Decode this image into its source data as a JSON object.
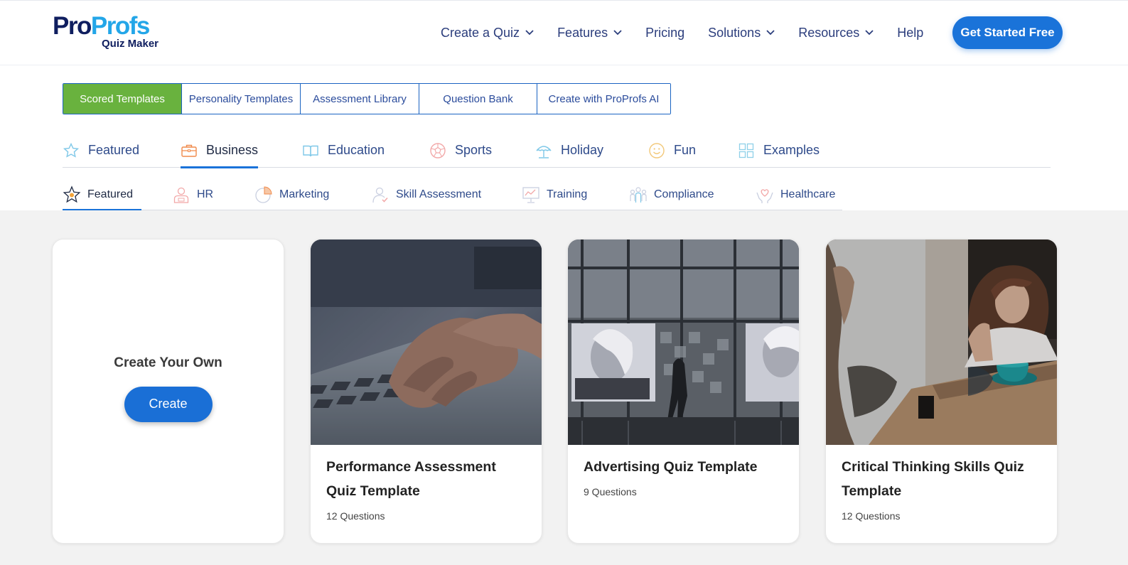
{
  "brand": {
    "name_part1": "Pro",
    "name_part2": "Profs",
    "sub": "Quiz Maker",
    "color_dark": "#0f1e5f",
    "color_light": "#23a6e8"
  },
  "nav": {
    "items": [
      {
        "label": "Create a Quiz",
        "dropdown": true
      },
      {
        "label": "Features",
        "dropdown": true
      },
      {
        "label": "Pricing",
        "dropdown": false
      },
      {
        "label": "Solutions",
        "dropdown": true
      },
      {
        "label": "Resources",
        "dropdown": true
      },
      {
        "label": "Help",
        "dropdown": false
      }
    ],
    "cta_label": "Get Started Free"
  },
  "type_tabs": [
    {
      "label": "Scored Templates",
      "active": true
    },
    {
      "label": "Personality Templates",
      "active": false
    },
    {
      "label": "Assessment Library",
      "active": false
    },
    {
      "label": "Question Bank",
      "active": false
    },
    {
      "label": "Create with ProProfs AI",
      "active": false
    }
  ],
  "category_tabs": [
    {
      "label": "Featured",
      "icon": "star-icon",
      "active": false
    },
    {
      "label": "Business",
      "icon": "briefcase-icon",
      "active": true
    },
    {
      "label": "Education",
      "icon": "book-icon",
      "active": false
    },
    {
      "label": "Sports",
      "icon": "ball-icon",
      "active": false
    },
    {
      "label": "Holiday",
      "icon": "umbrella-icon",
      "active": false
    },
    {
      "label": "Fun",
      "icon": "smiley-icon",
      "active": false
    },
    {
      "label": "Examples",
      "icon": "grid-icon",
      "active": false
    }
  ],
  "sub_tabs": [
    {
      "label": "Featured",
      "icon": "star-badge-icon",
      "active": true
    },
    {
      "label": "HR",
      "icon": "person-icon",
      "active": false
    },
    {
      "label": "Marketing",
      "icon": "pie-chart-icon",
      "active": false
    },
    {
      "label": "Skill Assessment",
      "icon": "person-check-icon",
      "active": false
    },
    {
      "label": "Training",
      "icon": "presentation-icon",
      "active": false
    },
    {
      "label": "Compliance",
      "icon": "group-icon",
      "active": false
    },
    {
      "label": "Healthcare",
      "icon": "heart-hands-icon",
      "active": false
    }
  ],
  "create_card": {
    "title": "Create Your Own",
    "button": "Create"
  },
  "templates": [
    {
      "title": "Performance Assessment Quiz Template",
      "questions": "12 Questions",
      "image": "laptop-typing-photo"
    },
    {
      "title": "Advertising Quiz Template",
      "questions": "9 Questions",
      "image": "building-billboards-photo"
    },
    {
      "title": "Critical Thinking Skills Quiz Template",
      "questions": "12 Questions",
      "image": "cafe-conversation-photo"
    }
  ],
  "colors": {
    "accent_blue": "#1a73d9",
    "active_green": "#69b23e",
    "nav_text": "#2b3d7c",
    "content_bg": "#f2f2f2"
  }
}
